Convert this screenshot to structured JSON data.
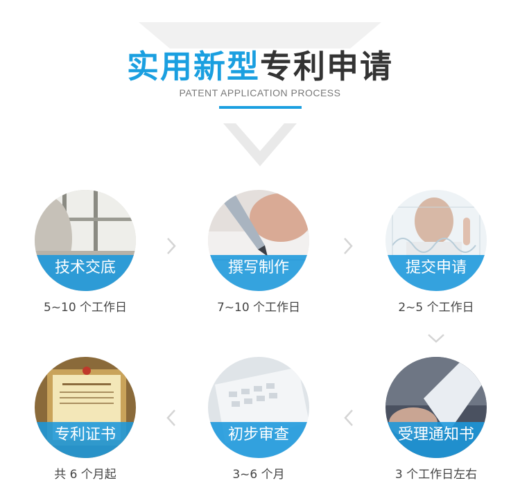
{
  "header": {
    "title_highlight": "实用新型",
    "title_rest": "专利申请",
    "subtitle": "PATENT APPLICATION PROCESS"
  },
  "steps": [
    {
      "label": "技术交底",
      "duration": "5~10 个工作日"
    },
    {
      "label": "撰写制作",
      "duration": "7~10 个工作日"
    },
    {
      "label": "提交申请",
      "duration": "2~5 个工作日"
    },
    {
      "label": "受理通知书",
      "duration": "3 个工作日左右"
    },
    {
      "label": "初步审查",
      "duration": "3~6 个月"
    },
    {
      "label": "专利证书",
      "duration": "共 6 个月起"
    }
  ],
  "icons": {
    "arrow_right": "chevron-right-icon",
    "arrow_left": "chevron-left-icon",
    "arrow_down": "chevron-down-icon"
  },
  "colors": {
    "accent": "#1a9fe0",
    "title_dark": "#333333",
    "band": "#1a97dc",
    "chevron": "#d4d4d4"
  }
}
